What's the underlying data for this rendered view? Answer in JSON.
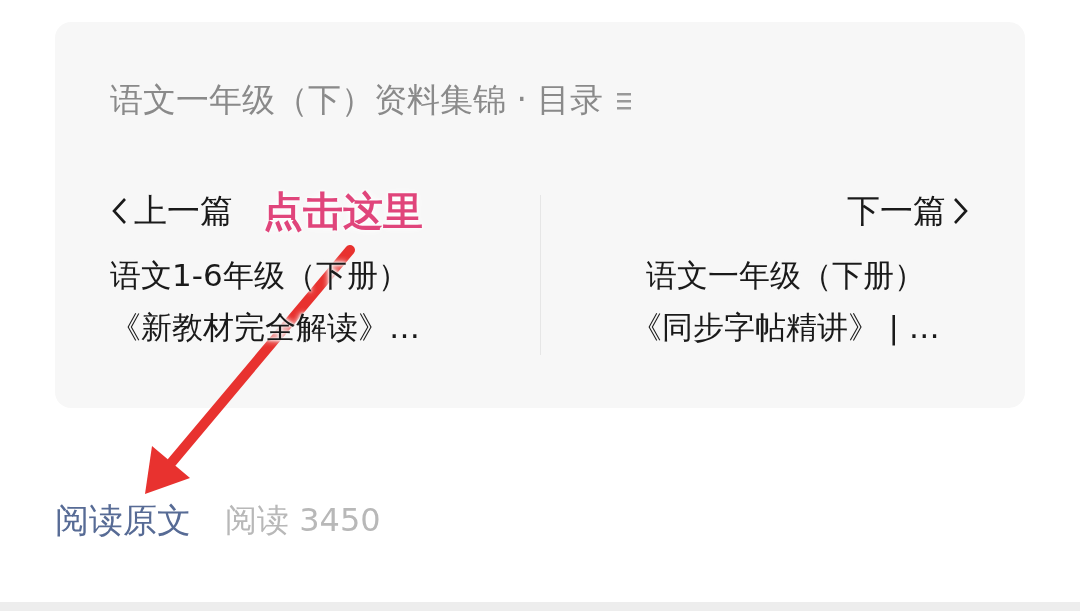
{
  "catalog": {
    "title": "语文一年级（下）资料集锦 · 目录"
  },
  "nav": [
    {
      "kind": "prev",
      "label": "上一篇",
      "lines": [
        "语文1-6年级（下册）",
        "《新教材完全解读》…"
      ]
    },
    {
      "kind": "next",
      "label": "下一篇",
      "lines": [
        "语文一年级（下册）",
        "《同步字帖精讲》 | …"
      ]
    }
  ],
  "annotation": {
    "text": "点击这里"
  },
  "footer": {
    "link": "阅读原文",
    "views": "阅读 3450"
  }
}
